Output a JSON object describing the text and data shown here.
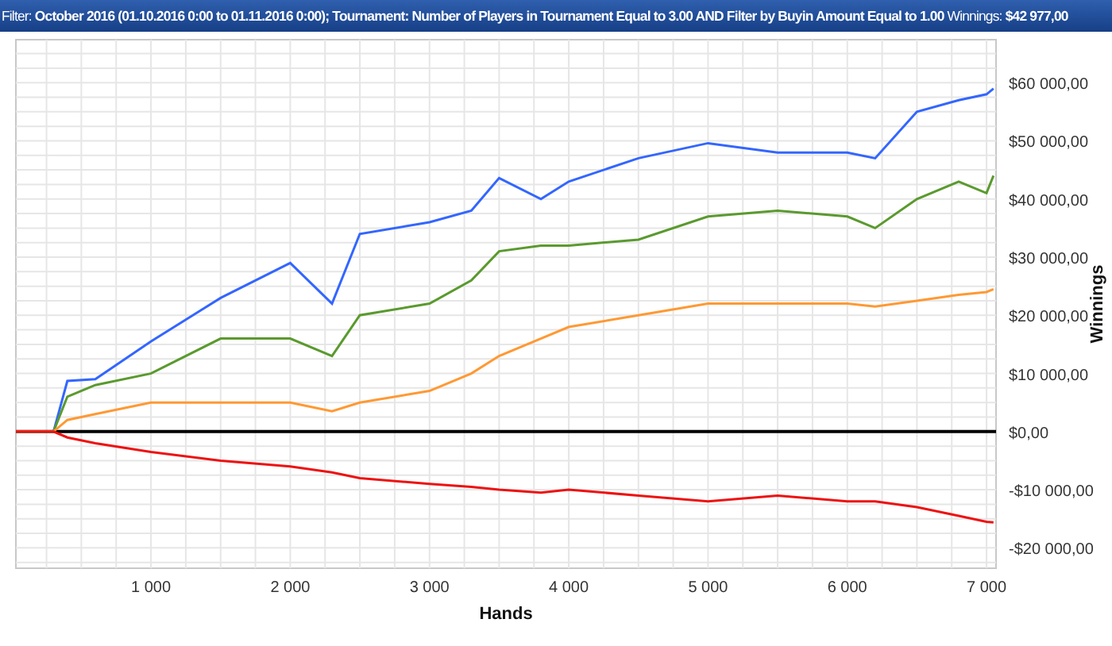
{
  "filter_bar": {
    "filter_label": "Filter:",
    "filter_text": "October 2016 (01.10.2016 0:00 to 01.11.2016 0:00); Tournament: Number of Players in Tournament Equal to 3.00 AND Filter by Buyin Amount Equal to 1.00",
    "winnings_label": "Winnings:",
    "winnings_value": "$42 977,00"
  },
  "chart": {
    "chart_data": {
      "type": "line",
      "grid": true,
      "xlabel": "Hands",
      "ylabel": "Winnings",
      "x": [
        30,
        300,
        400,
        600,
        1000,
        1500,
        2000,
        2300,
        2500,
        3000,
        3300,
        3500,
        3800,
        4000,
        4500,
        5000,
        5500,
        6000,
        6200,
        6500,
        6800,
        7000,
        7050
      ],
      "series": [
        {
          "color": "#3366ff",
          "values": [
            0,
            0,
            8700,
            9000,
            15500,
            23000,
            29000,
            22000,
            34000,
            36000,
            38000,
            43600,
            40000,
            43000,
            47000,
            49600,
            48000,
            48000,
            47000,
            55000,
            57000,
            58000,
            59000
          ]
        },
        {
          "color": "#5a9a2e",
          "values": [
            0,
            0,
            6000,
            8000,
            10000,
            16000,
            16000,
            13000,
            20000,
            22000,
            26000,
            31000,
            32000,
            32000,
            33000,
            37000,
            38000,
            37000,
            35000,
            40000,
            43000,
            41000,
            44000
          ]
        },
        {
          "color": "#ff9933",
          "values": [
            0,
            0,
            2000,
            3000,
            5000,
            5000,
            5000,
            3500,
            5000,
            7000,
            10000,
            13000,
            16000,
            18000,
            20000,
            22000,
            22000,
            22000,
            21500,
            22500,
            23500,
            24000,
            24500
          ]
        },
        {
          "color": "#ee1111",
          "values": [
            0,
            0,
            -1000,
            -2000,
            -3500,
            -5000,
            -6000,
            -7000,
            -8000,
            -9000,
            -9500,
            -10000,
            -10500,
            -10000,
            -11000,
            -12000,
            -11000,
            -12000,
            -12000,
            -13000,
            -14500,
            -15500,
            -15600
          ]
        }
      ],
      "xlim": [
        30,
        7068
      ],
      "ylim": [
        -23500,
        67400
      ],
      "xticks": [
        {
          "value": 1000,
          "label": "1 000"
        },
        {
          "value": 2000,
          "label": "2 000"
        },
        {
          "value": 3000,
          "label": "3 000"
        },
        {
          "value": 4000,
          "label": "4 000"
        },
        {
          "value": 5000,
          "label": "5 000"
        },
        {
          "value": 6000,
          "label": "6 000"
        },
        {
          "value": 7000,
          "label": "7 000"
        }
      ],
      "yticks": [
        {
          "value": -20000,
          "label": "-$20 000,00"
        },
        {
          "value": -10000,
          "label": "-$10 000,00"
        },
        {
          "value": 0,
          "label": "$0,00"
        },
        {
          "value": 10000,
          "label": "$10 000,00"
        },
        {
          "value": 20000,
          "label": "$20 000,00"
        },
        {
          "value": 30000,
          "label": "$30 000,00"
        },
        {
          "value": 40000,
          "label": "$40 000,00"
        },
        {
          "value": 50000,
          "label": "$50 000,00"
        },
        {
          "value": 60000,
          "label": "$60 000,00"
        }
      ]
    }
  }
}
